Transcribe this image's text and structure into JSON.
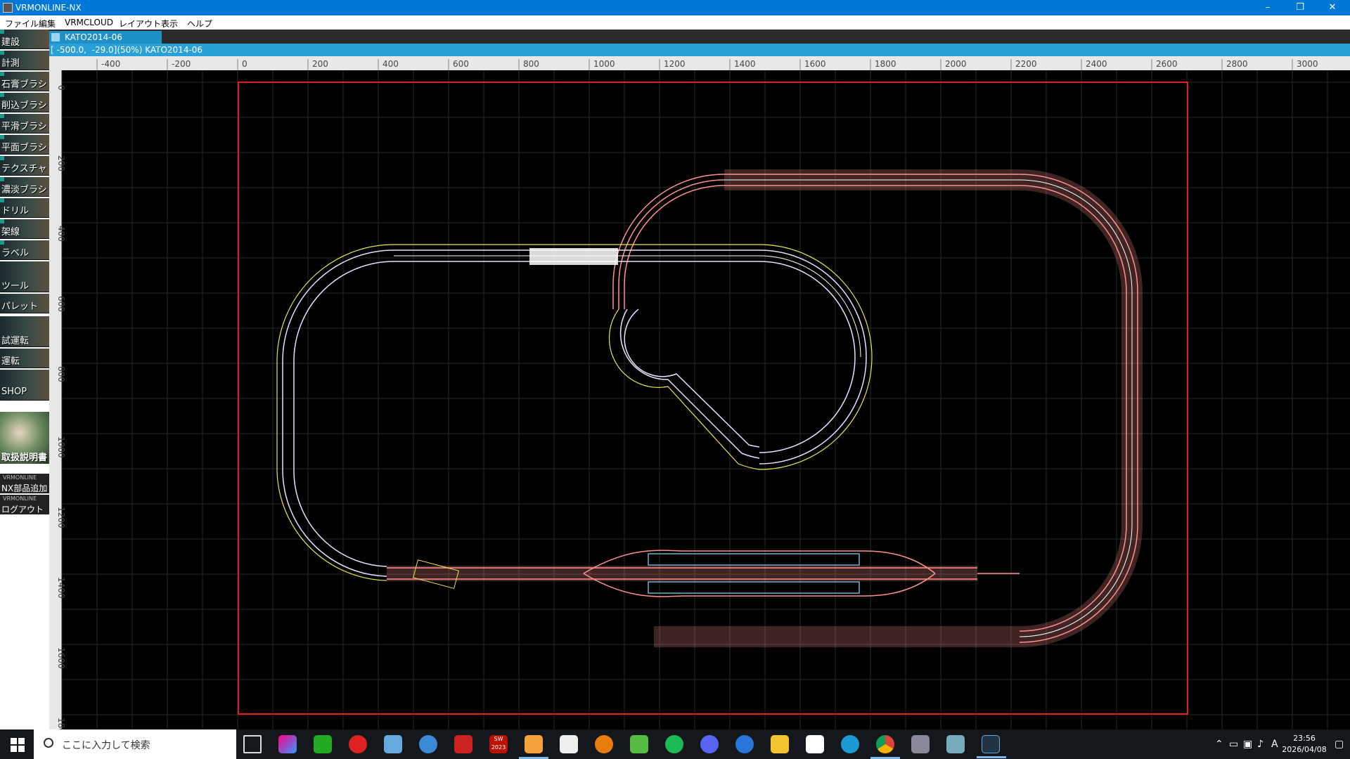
{
  "window": {
    "title": "VRMONLINE-NX",
    "minimize": "–",
    "maximize": "❐",
    "close": "✕"
  },
  "menu": [
    "ファイル",
    "編集",
    "VRMCLOUD",
    "レイアウト",
    "表示",
    "ヘルプ"
  ],
  "palette": {
    "items": [
      "建設",
      "計測",
      "石膏ブラシ",
      "削込ブラシ",
      "平滑ブラシ",
      "平面ブラシ",
      "テクスチャ",
      "濃淡ブラシ",
      "ドリル",
      "架線",
      "ラベル"
    ],
    "tools": [
      "ツール",
      "パレット"
    ],
    "run": [
      "試運転",
      "運転",
      "SHOP"
    ],
    "manual": "取扱説明書",
    "brand_small": "VRMONLINE",
    "nx_add": "NX部品追加",
    "logout": "ログアウト"
  },
  "layout_tab": "KATO2014-06",
  "status": "[ -500.0,  -29.0](50%) KATO2014-06",
  "ruler": {
    "top": [
      "-400",
      "-200",
      "0",
      "200",
      "400",
      "600",
      "800",
      "1000",
      "1200",
      "1400",
      "1600",
      "1800",
      "2000",
      "2200",
      "2400",
      "2600",
      "2800",
      "3000"
    ],
    "left": [
      "0",
      "200",
      "400",
      "600",
      "800",
      "1000",
      "1200",
      "1400",
      "1600",
      "180"
    ]
  },
  "taskbar": {
    "search_placeholder": "ここに入力して検索",
    "apps": [
      "task-view",
      "copilot",
      "phone-app",
      "music-player",
      "vpn",
      "paint-app",
      "cad-app",
      "solidworks-2023",
      "media-player",
      "swan-app",
      "blender",
      "maps-app",
      "spotify",
      "discord",
      "steam",
      "file-explorer",
      "solitaire",
      "edge",
      "chrome",
      "camera",
      "remote-desktop",
      "vrmonline-nx"
    ],
    "solidworks_label": "SW 2023",
    "ime": "A",
    "time": "23:56",
    "date": "2026/04/08"
  },
  "colors": {
    "titlebar": "#0078d7",
    "status_bar": "#2aa0d8",
    "layout_border": "#e02020",
    "track_main": "#ff9090",
    "track_selected": "#e8e0ff",
    "guide": "#e8e84a"
  }
}
